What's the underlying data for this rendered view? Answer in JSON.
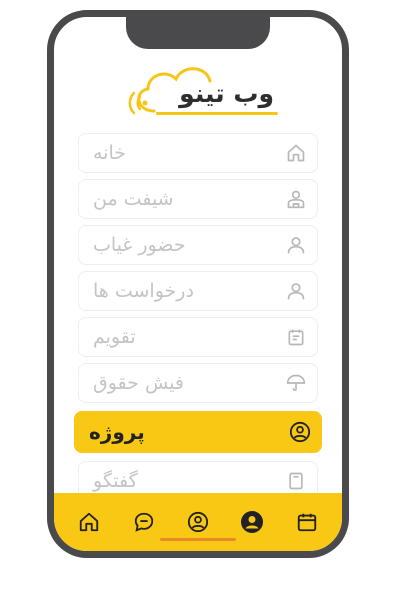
{
  "brand": {
    "logo_text": "وب تینو",
    "accent_color": "#f9c815"
  },
  "menu": {
    "items": [
      {
        "label": "خانه",
        "icon": "home-icon",
        "active": false
      },
      {
        "label": "شیفت من",
        "icon": "user-shift-icon",
        "active": false
      },
      {
        "label": "حضور غیاب",
        "icon": "person-icon",
        "active": false
      },
      {
        "label": "درخواست ها",
        "icon": "person-icon",
        "active": false
      },
      {
        "label": "تقویم",
        "icon": "calendar-icon",
        "active": false
      },
      {
        "label": "فیش حقوق",
        "icon": "umbrella-icon",
        "active": false
      },
      {
        "label": "پروژه",
        "icon": "user-circle-icon",
        "active": true
      },
      {
        "label": "گفتگو",
        "icon": "document-icon",
        "active": false
      }
    ]
  },
  "bottom_nav": {
    "items": [
      "home-icon",
      "chat-bubble-icon",
      "user-circle-icon",
      "profile-icon",
      "calendar-icon"
    ]
  }
}
